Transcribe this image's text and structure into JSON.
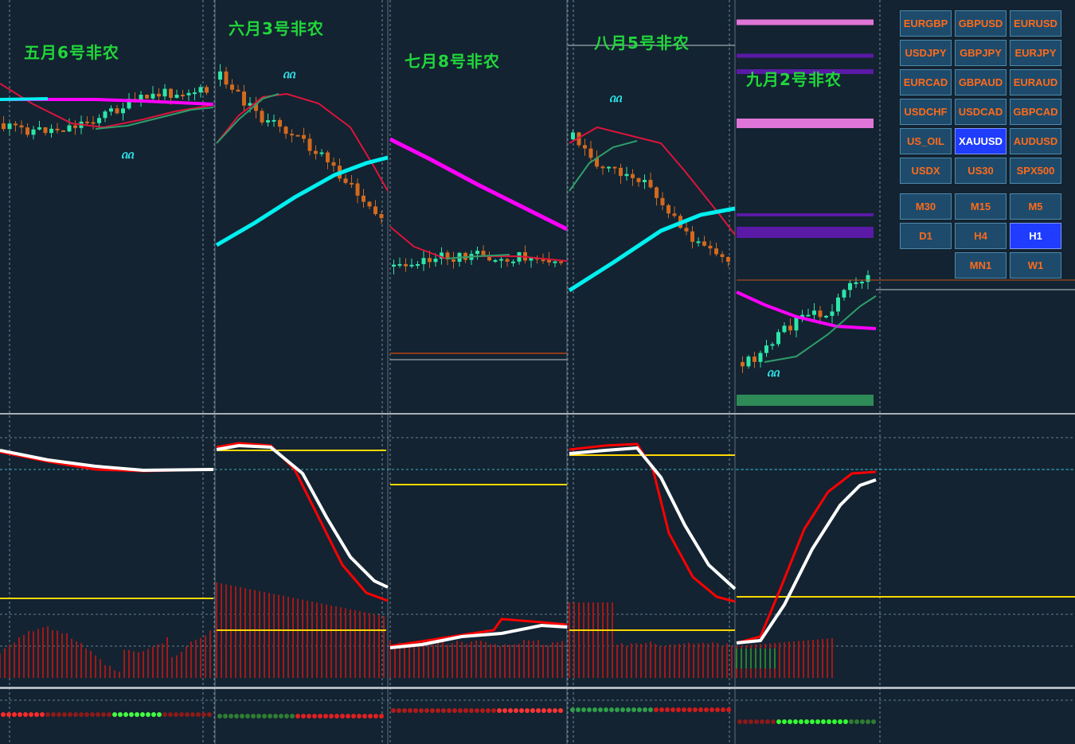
{
  "theme": {
    "background": "#132331",
    "bull": "#2ee6a8",
    "bear": "#d2691e",
    "ma_fast": "#dc143c",
    "ma_mid": "#2e9e6b",
    "ma_slow": "#ff00ff",
    "ma_long": "#00f0f0",
    "osc_main": "#ffffff",
    "osc_signal": "#ff0000",
    "level": "#ffd700",
    "hist": "#a31818"
  },
  "labels": {
    "may": "五月6号非农",
    "june": "六月3号非农",
    "july": "七月8号非农",
    "august": "八月5号非农",
    "september": "九月2号非农",
    "fractal_glyph": "ᦶ"
  },
  "symbols": {
    "eurgbp": "EURGBP",
    "gbpusd": "GBPUSD",
    "eurusd": "EURUSD",
    "usdjpy": "USDJPY",
    "gbpjpy": "GBPJPY",
    "eurjpy": "EURJPY",
    "eurcad": "EURCAD",
    "gbpaud": "GBPAUD",
    "euraud": "EURAUD",
    "usdchf": "USDCHF",
    "usdcad": "USDCAD",
    "gbpcad": "GBPCAD",
    "us_oil": "US_OIL",
    "xauusd": "XAUUSD",
    "audusd": "AUDUSD",
    "usdx": "USDX",
    "us30": "US30",
    "spx500": "SPX500",
    "active": "XAUUSD"
  },
  "timeframes": {
    "m30": "M30",
    "m15": "M15",
    "m5": "M5",
    "d1": "D1",
    "h4": "H4",
    "h1": "H1",
    "mn1": "MN1",
    "w1": "W1",
    "active": "H1"
  }
}
